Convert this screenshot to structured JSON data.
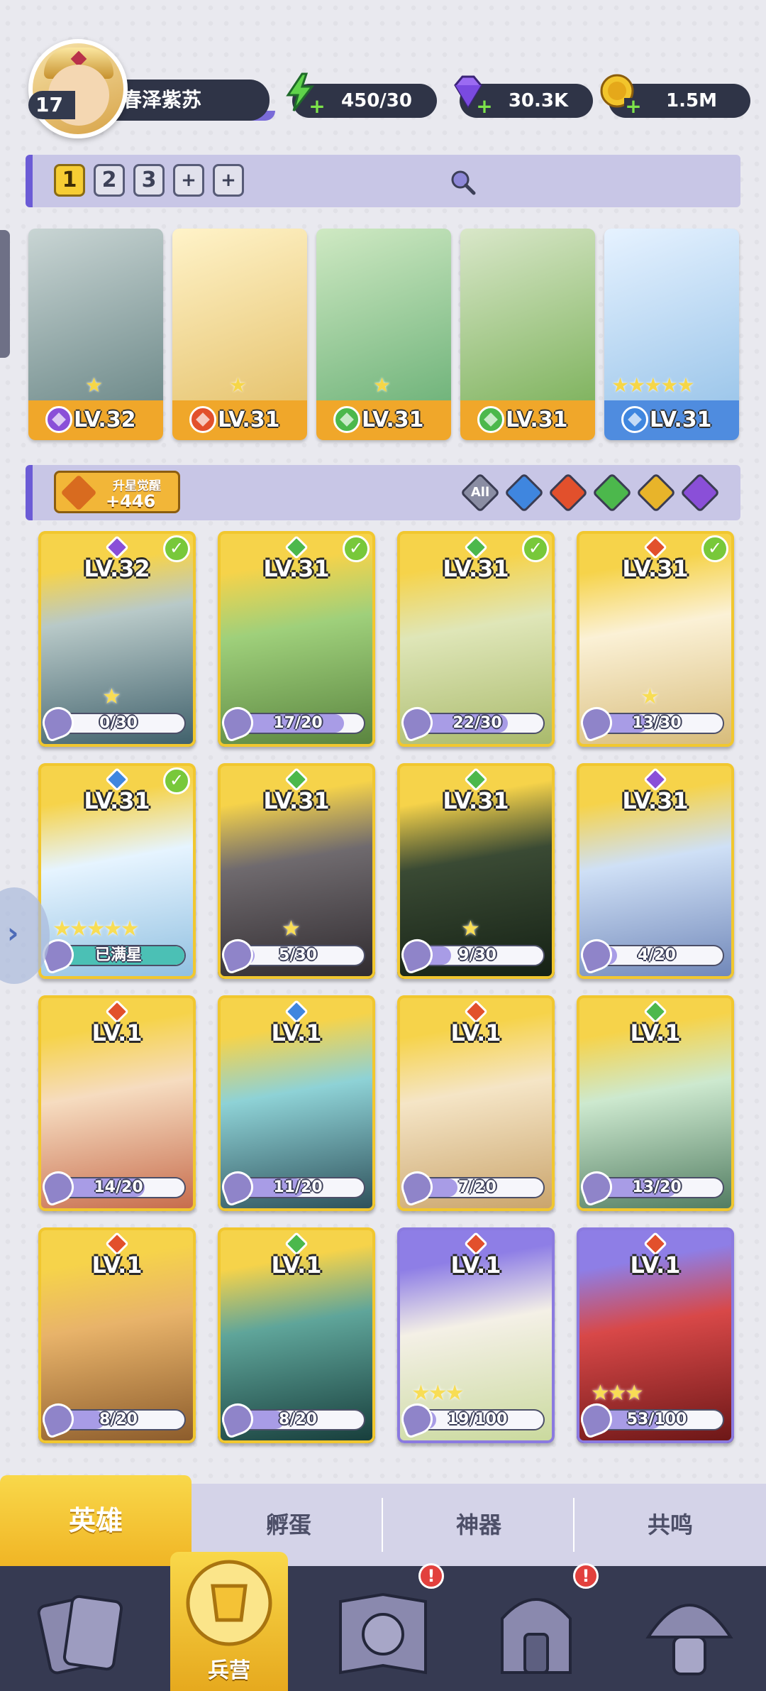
{
  "player": {
    "level": "17",
    "name": "春泽紫苏"
  },
  "resources": {
    "energy": "450/30",
    "gems": "30.3K",
    "gold": "1.5M",
    "plus_sign": "+"
  },
  "team_tabs": [
    "1",
    "2",
    "3",
    "+",
    "+"
  ],
  "team_heroes": [
    {
      "level": "LV.32",
      "element": "dark",
      "stars": "★"
    },
    {
      "level": "LV.31",
      "element": "fire",
      "stars": "★"
    },
    {
      "level": "LV.31",
      "element": "wind",
      "stars": "★"
    },
    {
      "level": "LV.31",
      "element": "wind",
      "stars": ""
    },
    {
      "level": "LV.31",
      "element": "water",
      "stars": "★★★★★"
    }
  ],
  "awaken": {
    "label": "升星觉醒",
    "count": "+446"
  },
  "filters": {
    "all_label": "All",
    "elements": [
      "water",
      "fire",
      "wind",
      "light",
      "dark"
    ]
  },
  "element_colors": {
    "dark": "#8a4fd8",
    "fire": "#e2502c",
    "wind": "#4cb84c",
    "water": "#3f86df",
    "light": "#e8b42a"
  },
  "heroes": [
    {
      "level": "LV.32",
      "element": "dark",
      "progress": "0/30",
      "fraction": 0.0,
      "check": true,
      "stars": "★",
      "frame": "gold"
    },
    {
      "level": "LV.31",
      "element": "wind",
      "progress": "17/20",
      "fraction": 0.85,
      "check": true,
      "stars": "",
      "frame": "gold"
    },
    {
      "level": "LV.31",
      "element": "wind",
      "progress": "22/30",
      "fraction": 0.73,
      "check": true,
      "stars": "",
      "frame": "gold"
    },
    {
      "level": "LV.31",
      "element": "fire",
      "progress": "13/30",
      "fraction": 0.43,
      "check": true,
      "stars": "★",
      "frame": "gold"
    },
    {
      "level": "LV.31",
      "element": "water",
      "progress": "已满星",
      "fraction": 1.0,
      "check": true,
      "stars": "★★★★★",
      "frame": "gold",
      "full": true
    },
    {
      "level": "LV.31",
      "element": "wind",
      "progress": "5/30",
      "fraction": 0.17,
      "check": false,
      "stars": "★",
      "frame": "gold"
    },
    {
      "level": "LV.31",
      "element": "wind",
      "progress": "9/30",
      "fraction": 0.3,
      "check": false,
      "stars": "★",
      "frame": "gold"
    },
    {
      "level": "LV.31",
      "element": "dark",
      "progress": "4/20",
      "fraction": 0.2,
      "check": false,
      "stars": "",
      "frame": "gold"
    },
    {
      "level": "LV.1",
      "element": "fire",
      "progress": "14/20",
      "fraction": 0.7,
      "check": false,
      "stars": "",
      "frame": "gold"
    },
    {
      "level": "LV.1",
      "element": "water",
      "progress": "11/20",
      "fraction": 0.55,
      "check": false,
      "stars": "",
      "frame": "gold"
    },
    {
      "level": "LV.1",
      "element": "fire",
      "progress": "7/20",
      "fraction": 0.35,
      "check": false,
      "stars": "",
      "frame": "gold"
    },
    {
      "level": "LV.1",
      "element": "wind",
      "progress": "13/20",
      "fraction": 0.65,
      "check": false,
      "stars": "",
      "frame": "gold"
    },
    {
      "level": "LV.1",
      "element": "fire",
      "progress": "8/20",
      "fraction": 0.4,
      "check": false,
      "stars": "",
      "frame": "gold"
    },
    {
      "level": "LV.1",
      "element": "wind",
      "progress": "8/20",
      "fraction": 0.4,
      "check": false,
      "stars": "",
      "frame": "gold"
    },
    {
      "level": "LV.1",
      "element": "fire",
      "progress": "19/100",
      "fraction": 0.19,
      "check": false,
      "stars": "★★★",
      "frame": "purple"
    },
    {
      "level": "LV.1",
      "element": "fire",
      "progress": "53/100",
      "fraction": 0.53,
      "check": false,
      "stars": "★★★",
      "frame": "purple"
    }
  ],
  "sub_tabs": [
    "英雄",
    "孵蛋",
    "神器",
    "共鸣"
  ],
  "nav": {
    "barracks_label": "兵营",
    "alert_mark": "!"
  }
}
